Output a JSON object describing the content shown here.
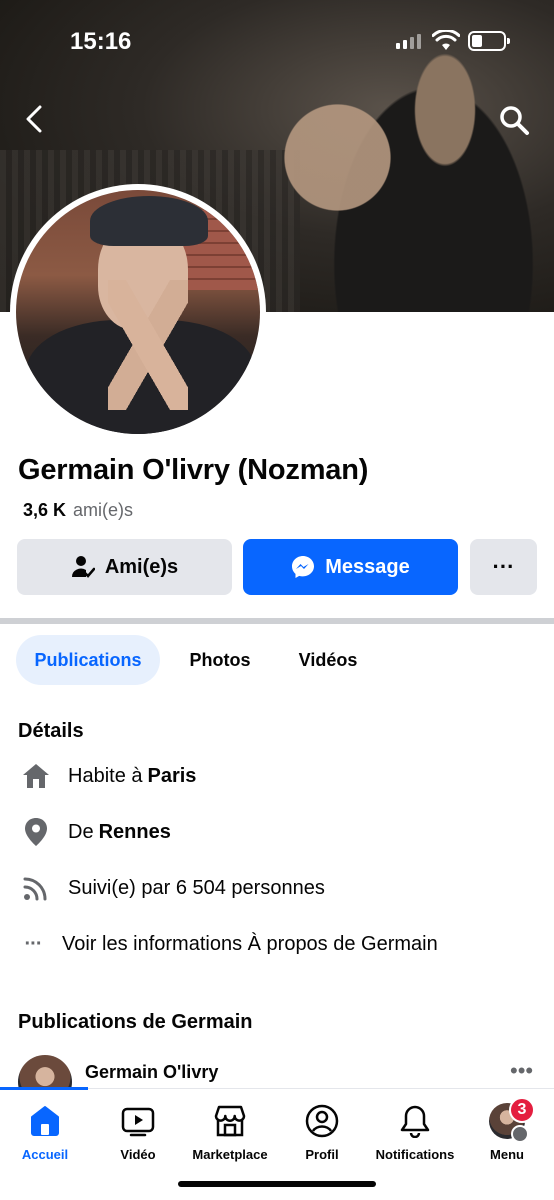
{
  "status_bar": {
    "time": "15:16"
  },
  "profile": {
    "name": "Germain O'livry (Nozman)",
    "friends_count": "3,6 K",
    "friends_label": "ami(e)s"
  },
  "actions": {
    "friends_label": "Ami(e)s",
    "message_label": "Message",
    "more_label": "···"
  },
  "tabs": [
    {
      "label": "Publications",
      "active": true
    },
    {
      "label": "Photos",
      "active": false
    },
    {
      "label": "Vidéos",
      "active": false
    }
  ],
  "details": {
    "title": "Détails",
    "lives_prefix": "Habite à",
    "lives_city": "Paris",
    "from_prefix": "De",
    "from_city": "Rennes",
    "followers": "Suivi(e) par 6 504 personnes",
    "about_link": "Voir les informations À propos de Germain",
    "about_icon": "···"
  },
  "posts": {
    "title": "Publications de Germain",
    "first_author": "Germain O'livry",
    "more": "•••"
  },
  "bottom_nav": [
    {
      "label": "Accueil",
      "icon": "home-icon",
      "active": true
    },
    {
      "label": "Vidéo",
      "icon": "video-icon",
      "active": false
    },
    {
      "label": "Marketplace",
      "icon": "marketplace-icon",
      "active": false
    },
    {
      "label": "Profil",
      "icon": "profile-icon",
      "active": false
    },
    {
      "label": "Notifications",
      "icon": "bell-icon",
      "active": false
    },
    {
      "label": "Menu",
      "icon": "menu-avatar",
      "active": false,
      "badge": "3"
    }
  ],
  "colors": {
    "accent": "#0866ff",
    "button_gray": "#e4e6eb",
    "badge": "#e41e3f",
    "secondary_text": "#65676b"
  }
}
